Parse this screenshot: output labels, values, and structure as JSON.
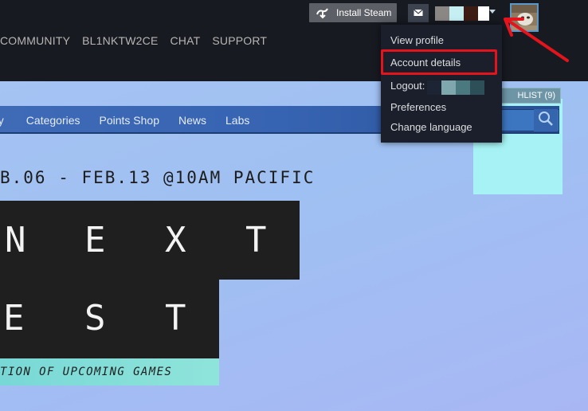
{
  "header": {
    "install_label": "Install Steam",
    "mail_icon": "envelope-icon",
    "account_swatch_colors": [
      "#8a8784",
      "#c5eff3",
      "#3d1c14",
      "#ffffff"
    ],
    "nav_items": [
      "COMMUNITY",
      "BL1NKTW2CE",
      "CHAT",
      "SUPPORT"
    ]
  },
  "wishlist": {
    "label": "HLIST (9)"
  },
  "store_nav": {
    "tabs": [
      "hy",
      "Categories",
      "Points Shop",
      "News",
      "Labs"
    ],
    "search_icon": "search-icon"
  },
  "hero": {
    "date_line": "B.06 - FEB.13 @10AM PACIFIC",
    "row1_letters": [
      "N",
      "E",
      "X",
      "T"
    ],
    "row2_letters": [
      "E",
      "S",
      "T"
    ],
    "tagline": "TION  OF UPCOMING GAMES"
  },
  "dropdown": {
    "items": {
      "view_profile": "View profile",
      "account_details": "Account details",
      "logout": "Logout:",
      "preferences": "Preferences",
      "change_language": "Change language"
    },
    "logout_swatch_colors": [
      "#1d2433",
      "#7fa7ae",
      "#4a7a80",
      "#2c4f58"
    ]
  },
  "annotation": {
    "highlight_color": "#e3141c",
    "arrow_color": "#e3141c"
  }
}
